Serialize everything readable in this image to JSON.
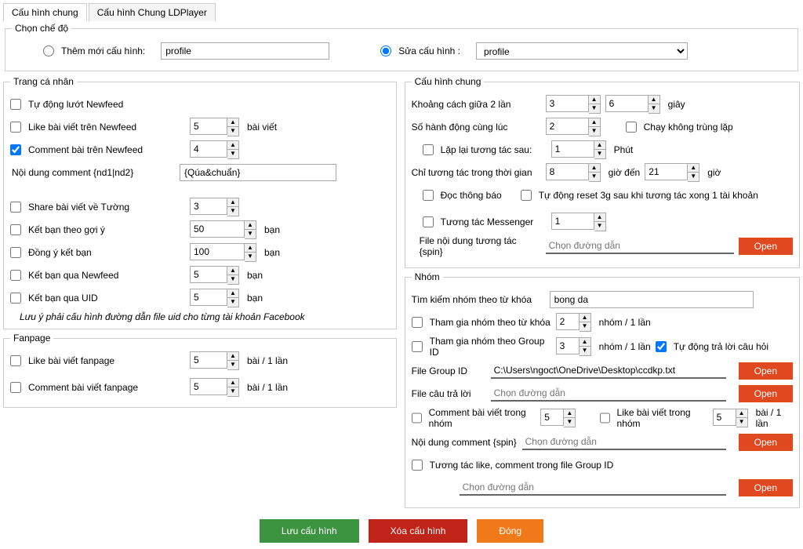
{
  "tabs": {
    "general": "Cấu hình chung",
    "ld": "Cấu hình Chung LDPlayer"
  },
  "mode": {
    "legend": "Chọn chế độ",
    "add_label": "Thêm mới cấu hình:",
    "add_value": "profile",
    "edit_label": "Sửa cấu hình :",
    "edit_value": "profile"
  },
  "profile": {
    "legend": "Trang cá nhân",
    "auto_scroll": "Tự động lướt Newfeed",
    "like_nf": "Like bài viết trên Newfeed",
    "like_nf_val": "5",
    "like_nf_unit": "bài viết",
    "cmt_nf": "Comment bài trên Newfeed",
    "cmt_nf_val": "4",
    "cmt_content_lbl": "Nội dung comment {nd1|nd2}",
    "cmt_content_val": "{Qúa&chuẩn}",
    "share": "Share bài viết về Tường",
    "share_val": "3",
    "friend_sug": "Kết bạn theo gợi ý",
    "friend_sug_val": "50",
    "friend_unit": "bạn",
    "accept": "Đồng ý kết bạn",
    "accept_val": "100",
    "friend_nf": "Kết bạn qua Newfeed",
    "friend_nf_val": "5",
    "friend_uid": "Kết bạn qua UID",
    "friend_uid_val": "5",
    "note": "Lưu ý phải cấu hình đường dẫn file uid cho từng tài khoản Facebook"
  },
  "fanpage": {
    "legend": "Fanpage",
    "like": "Like bài viết fanpage",
    "like_val": "5",
    "unit": "bài / 1 lần",
    "cmt": "Comment bài viết fanpage",
    "cmt_val": "5"
  },
  "general": {
    "legend": "Cấu hình chung",
    "gap_lbl": "Khoảng cách giữa 2 lần",
    "gap_min": "3",
    "gap_max": "6",
    "gap_unit": "giây",
    "actions_lbl": "Số hành động cùng lúc",
    "actions_val": "2",
    "nodup": "Chạy không trùng lặp",
    "repeat": "Lặp lại tương tác sau:",
    "repeat_val": "1",
    "repeat_unit": "Phút",
    "time_lbl": "Chỉ tương tác trong thời gian",
    "time_from": "8",
    "time_to_lbl": "giờ đến",
    "time_to": "21",
    "time_unit": "giờ",
    "read_noti": "Đọc thông báo",
    "reset3g": "Tự động reset 3g sau khi tương tác xong 1 tài khoản",
    "msgr": "Tương tác Messenger",
    "msgr_val": "1",
    "file_lbl": "File nội dung tương tác {spin}",
    "file_ph": "Chọn đường dẫn",
    "open": "Open"
  },
  "group": {
    "legend": "Nhóm",
    "search_lbl": "Tìm kiếm nhóm theo từ khóa",
    "search_val": "bong da",
    "join_kw": "Tham gia nhóm theo từ khóa",
    "join_kw_val": "2",
    "join_unit": "nhóm / 1 lần",
    "join_id": "Tham gia nhóm theo Group ID",
    "join_id_val": "3",
    "auto_ans": "Tự động trả lời câu hỏi",
    "file_gid_lbl": "File Group ID",
    "file_gid_val": "C:\\Users\\ngoct\\OneDrive\\Desktop\\ccdkp.txt",
    "file_ans_lbl": "File câu trả lời",
    "path_ph": "Chọn đường dẫn",
    "cmt_group": "Comment bài viết trong nhóm",
    "cmt_group_val": "5",
    "like_group": "Like bài viết trong nhóm",
    "like_group_val": "5",
    "like_group_unit": "bài / 1 lần",
    "cmt_content_lbl": "Nội dung comment {spin}",
    "interact_file": "Tương tác like, comment trong file Group ID",
    "open": "Open"
  },
  "footer": {
    "save": "Lưu cấu hình",
    "del": "Xóa cấu hình",
    "close": "Đóng"
  }
}
